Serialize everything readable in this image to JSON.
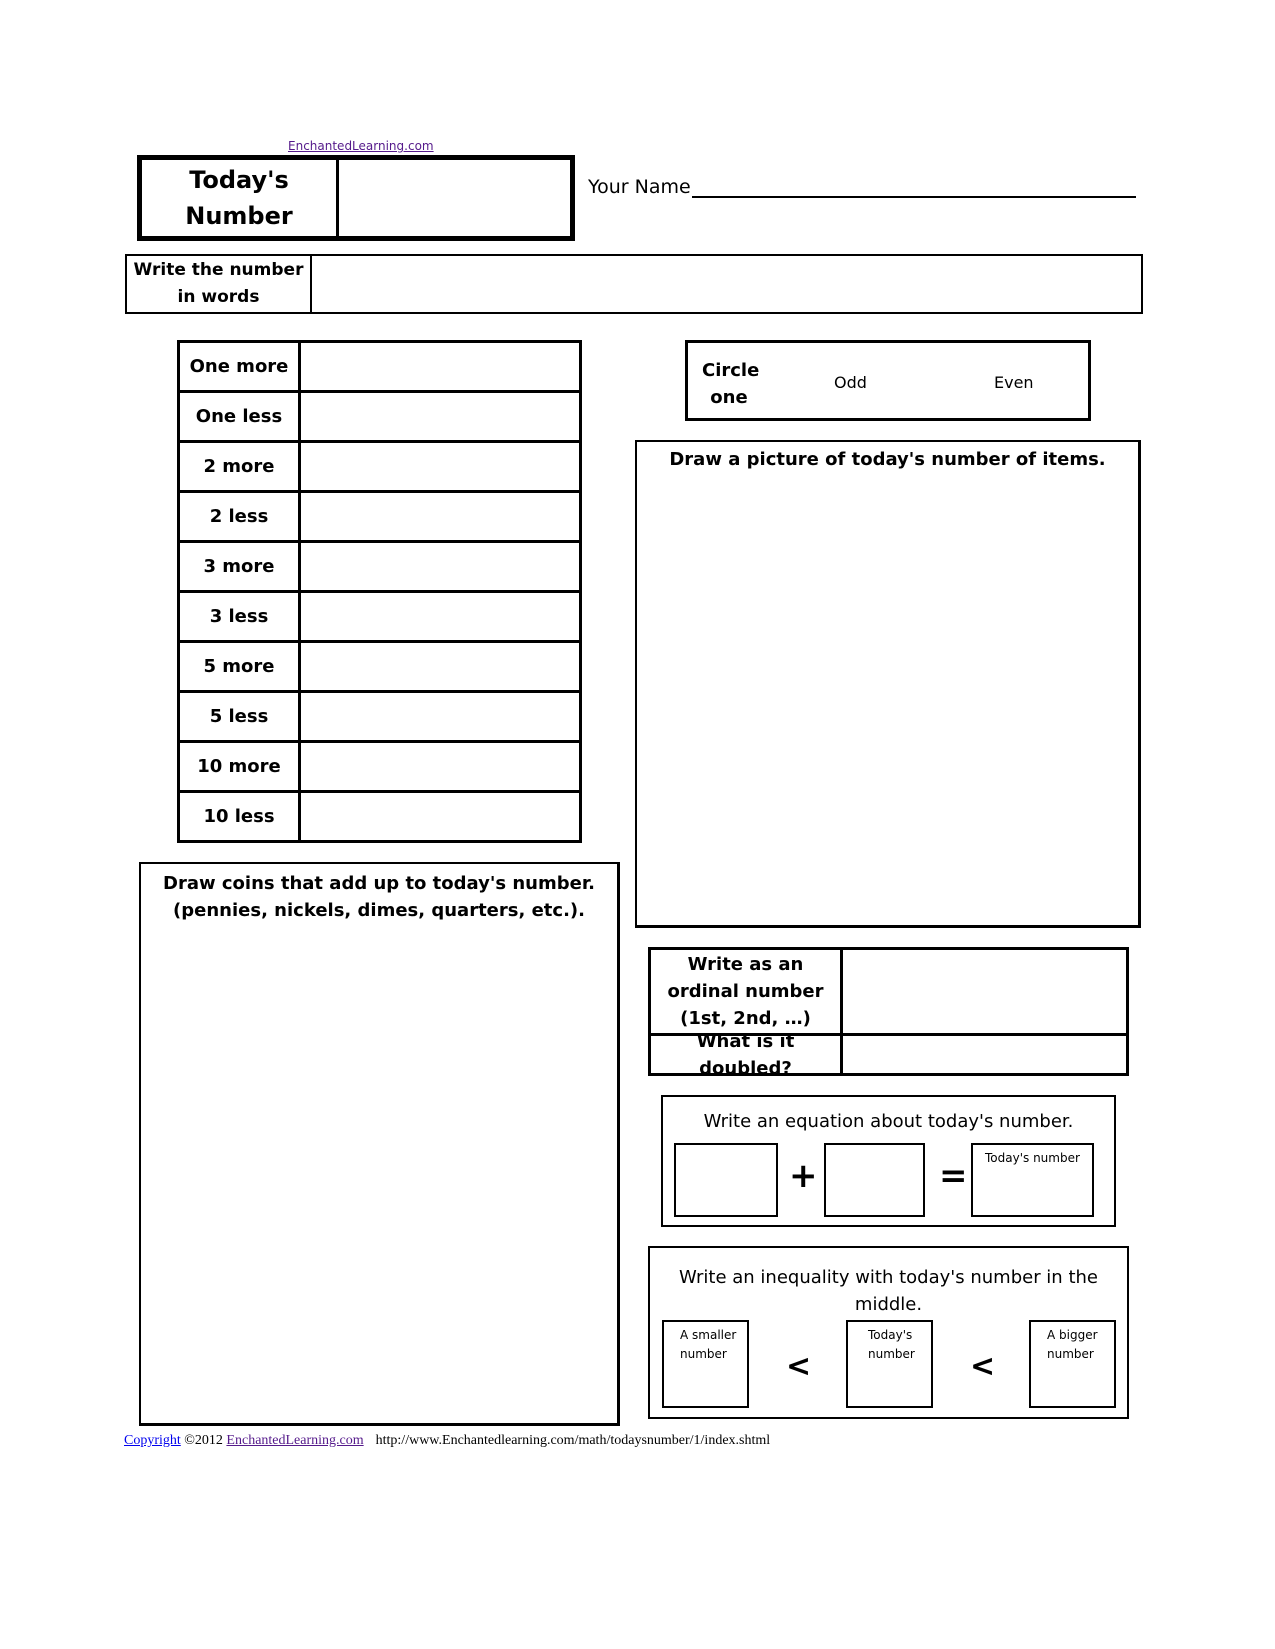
{
  "header": {
    "site_link": "EnchantedLearning.com",
    "todays_number_label": "Today's Number",
    "your_name_label": "Your Name"
  },
  "words_row": {
    "label": "Write the number in words"
  },
  "operations": [
    {
      "label": "One more"
    },
    {
      "label": "One less"
    },
    {
      "label": "2 more"
    },
    {
      "label": "2 less"
    },
    {
      "label": "3 more"
    },
    {
      "label": "3 less"
    },
    {
      "label": "5 more"
    },
    {
      "label": "5 less"
    },
    {
      "label": "10 more"
    },
    {
      "label": "10 less"
    }
  ],
  "circle_one": {
    "label": "Circle one",
    "options": [
      "Odd",
      "Even"
    ]
  },
  "picture_box": {
    "title": "Draw a picture of today's number of items."
  },
  "coins_box": {
    "title_line1": "Draw coins that add up to today's number.",
    "title_line2": "(pennies, nickels, dimes, quarters, etc.)."
  },
  "ordinal_table": {
    "ordinal_label": "Write as an ordinal number (1st, 2nd, …)",
    "doubled_label": "What is it doubled?"
  },
  "equation": {
    "title": "Write an equation about today's number.",
    "plus": "+",
    "equals": "=",
    "result_label": "Today's number"
  },
  "inequality": {
    "title": "Write an inequality with today's number in the middle.",
    "smaller_label": "A smaller number",
    "middle_label": "Today's number",
    "bigger_label": "A bigger number",
    "operator": "<"
  },
  "footer": {
    "copyright_link": "Copyright",
    "copyright_text": " ©2012 ",
    "site_link": "EnchantedLearning.com",
    "url": "http://www.Enchantedlearning.com/math/todaysnumber/1/index.shtml"
  }
}
